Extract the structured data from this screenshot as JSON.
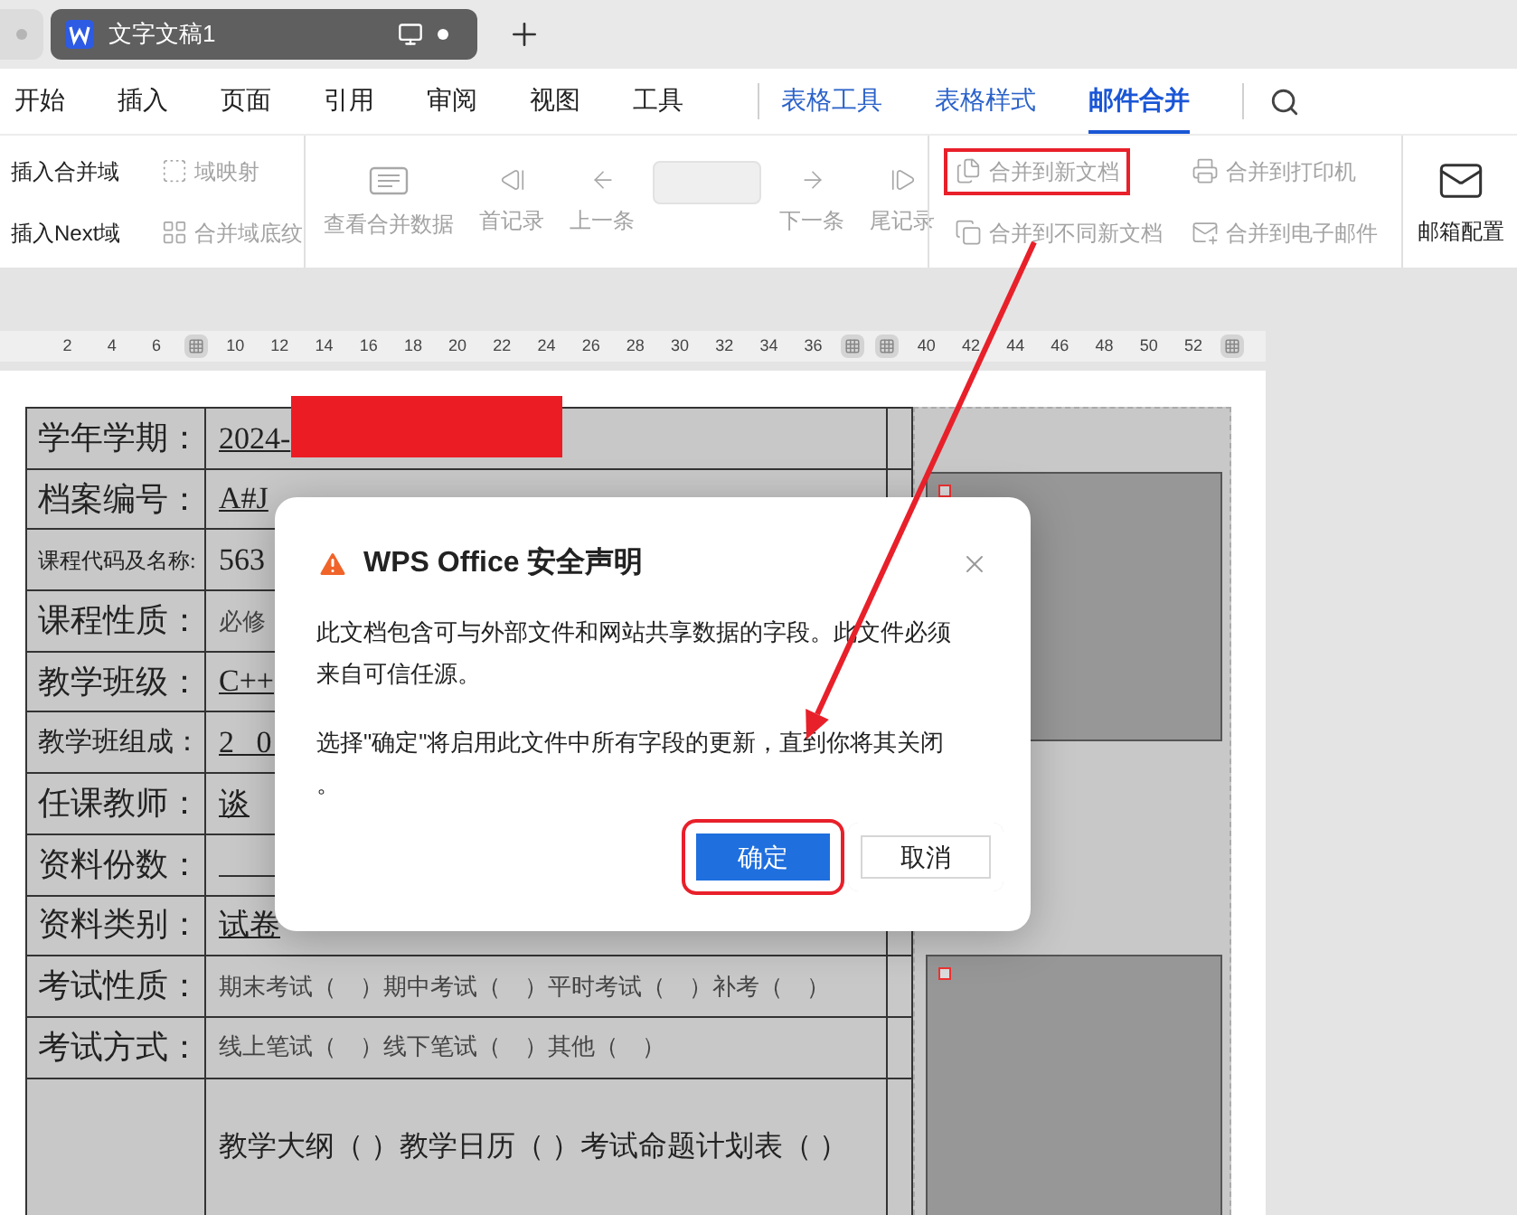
{
  "window": {
    "tabs": [
      {
        "title": "文字文稿1",
        "selected": true
      }
    ]
  },
  "ribbon_tabs": [
    {
      "label": "开始",
      "kind": "main",
      "selected": false
    },
    {
      "label": "插入",
      "kind": "main",
      "selected": false
    },
    {
      "label": "页面",
      "kind": "main",
      "selected": false
    },
    {
      "label": "引用",
      "kind": "main",
      "selected": false
    },
    {
      "label": "审阅",
      "kind": "main",
      "selected": false
    },
    {
      "label": "视图",
      "kind": "main",
      "selected": false
    },
    {
      "label": "工具",
      "kind": "main",
      "selected": false
    },
    {
      "label": "表格工具",
      "kind": "context",
      "selected": false
    },
    {
      "label": "表格样式",
      "kind": "context",
      "selected": false
    },
    {
      "label": "邮件合并",
      "kind": "context",
      "selected": true
    }
  ],
  "toolbar": {
    "groups": [
      {
        "columns": [
          {
            "kind": "stack",
            "items": [
              {
                "label": "插入合并域",
                "disabled": false,
                "highlighted": false
              },
              {
                "label": "插入Next域",
                "disabled": false,
                "highlighted": false
              }
            ]
          },
          {
            "kind": "stack",
            "items": [
              {
                "label": "域映射",
                "disabled": true,
                "highlighted": false
              },
              {
                "label": "合并域底纹",
                "disabled": true,
                "highlighted": false
              }
            ]
          }
        ]
      },
      {
        "columns": [
          {
            "kind": "large",
            "items": [
              {
                "label": "查看合并数据",
                "disabled": true,
                "highlighted": false
              }
            ]
          },
          {
            "kind": "large",
            "items": [
              {
                "label": "首记录",
                "disabled": true,
                "highlighted": false
              }
            ]
          },
          {
            "kind": "large",
            "items": [
              {
                "label": "上一条",
                "disabled": true,
                "highlighted": false
              }
            ]
          },
          {
            "kind": "field",
            "items": [
              {
                "disabled": true,
                "highlighted": false
              }
            ]
          },
          {
            "kind": "large",
            "items": [
              {
                "label": "下一条",
                "disabled": true,
                "highlighted": false
              }
            ]
          },
          {
            "kind": "large",
            "items": [
              {
                "label": "尾记录",
                "disabled": true,
                "highlighted": false
              }
            ]
          }
        ]
      },
      {
        "columns": [
          {
            "kind": "stack",
            "items": [
              {
                "label": "合并到新文档",
                "disabled": true,
                "highlighted": true
              },
              {
                "label": "合并到不同新文档",
                "disabled": true,
                "highlighted": false
              }
            ]
          },
          {
            "kind": "stack",
            "items": [
              {
                "label": "合并到打印机",
                "disabled": true,
                "highlighted": false
              },
              {
                "label": "合并到电子邮件",
                "disabled": true,
                "highlighted": false
              }
            ]
          }
        ]
      },
      {
        "columns": [
          {
            "kind": "large",
            "items": [
              {
                "label": "邮箱配置",
                "disabled": false,
                "highlighted": false
              }
            ]
          }
        ]
      }
    ]
  },
  "ruler": [
    {
      "kind": "number",
      "label": "2"
    },
    {
      "kind": "number",
      "label": "4"
    },
    {
      "kind": "number",
      "label": "6"
    },
    {
      "kind": "handle"
    },
    {
      "kind": "number",
      "label": "10"
    },
    {
      "kind": "number",
      "label": "12"
    },
    {
      "kind": "number",
      "label": "14"
    },
    {
      "kind": "number",
      "label": "16"
    },
    {
      "kind": "number",
      "label": "18"
    },
    {
      "kind": "number",
      "label": "20"
    },
    {
      "kind": "number",
      "label": "22"
    },
    {
      "kind": "number",
      "label": "24"
    },
    {
      "kind": "number",
      "label": "26"
    },
    {
      "kind": "number",
      "label": "28"
    },
    {
      "kind": "number",
      "label": "30"
    },
    {
      "kind": "number",
      "label": "32"
    },
    {
      "kind": "number",
      "label": "34"
    },
    {
      "kind": "number",
      "label": "36"
    },
    {
      "kind": "handle"
    },
    {
      "kind": "handle"
    },
    {
      "kind": "number",
      "label": "40"
    },
    {
      "kind": "number",
      "label": "42"
    },
    {
      "kind": "number",
      "label": "44"
    },
    {
      "kind": "number",
      "label": "46"
    },
    {
      "kind": "number",
      "label": "48"
    },
    {
      "kind": "number",
      "label": "50"
    },
    {
      "kind": "number",
      "label": "52"
    },
    {
      "kind": "handle"
    }
  ],
  "document": {
    "rows": [
      {
        "label": "学年学期：",
        "small_label": false,
        "condensed_label": false,
        "kind": "redacted",
        "value": "2024-"
      },
      {
        "label": "档案编号：",
        "small_label": false,
        "condensed_label": false,
        "kind": "underlined",
        "value": "A#J"
      },
      {
        "label": "课程代码及名称:",
        "small_label": true,
        "condensed_label": false,
        "kind": "plain",
        "value": "563"
      },
      {
        "label": "课程性质：",
        "small_label": false,
        "condensed_label": false,
        "kind": "options",
        "value": "必修"
      },
      {
        "label": "教学班级：",
        "small_label": false,
        "condensed_label": false,
        "kind": "underlined",
        "value": "C++"
      },
      {
        "label": "教学班组成：",
        "small_label": false,
        "condensed_label": true,
        "kind": "underlined",
        "value": "2 0"
      },
      {
        "label": "任课教师：",
        "small_label": false,
        "condensed_label": false,
        "kind": "underlined",
        "value": "谈"
      },
      {
        "label": "资料份数：",
        "small_label": false,
        "condensed_label": false,
        "kind": "blank"
      },
      {
        "label": "资料类别：",
        "small_label": false,
        "condensed_label": false,
        "kind": "underlined",
        "value": "试卷"
      },
      {
        "label": "考试性质：",
        "small_label": false,
        "condensed_label": false,
        "kind": "options",
        "value": "期末考试（　）期中考试（　）平时考试（　）补考（　）"
      },
      {
        "label": "考试方式：",
        "small_label": false,
        "condensed_label": false,
        "kind": "options",
        "value": "线上笔试（　）线下笔试（　）其他（　）"
      },
      {
        "kind": "tall",
        "value": "教学大纲（ ）教学日历（ ）考试命题计划表（ ）"
      }
    ]
  },
  "dialog": {
    "title": "WPS Office 安全声明",
    "paragraphs": [
      [
        "此文档包含可与外部文件和网站共享数据的字段。此文件必须",
        "来自可信任源。"
      ],
      [
        "选择\"确定\"将启用此文件中所有字段的更新，直到你将其关闭",
        "。"
      ]
    ],
    "buttons": [
      {
        "label": "确定",
        "kind": "primary",
        "highlighted": true
      },
      {
        "label": "取消",
        "kind": "secondary",
        "highlighted": false
      }
    ]
  }
}
